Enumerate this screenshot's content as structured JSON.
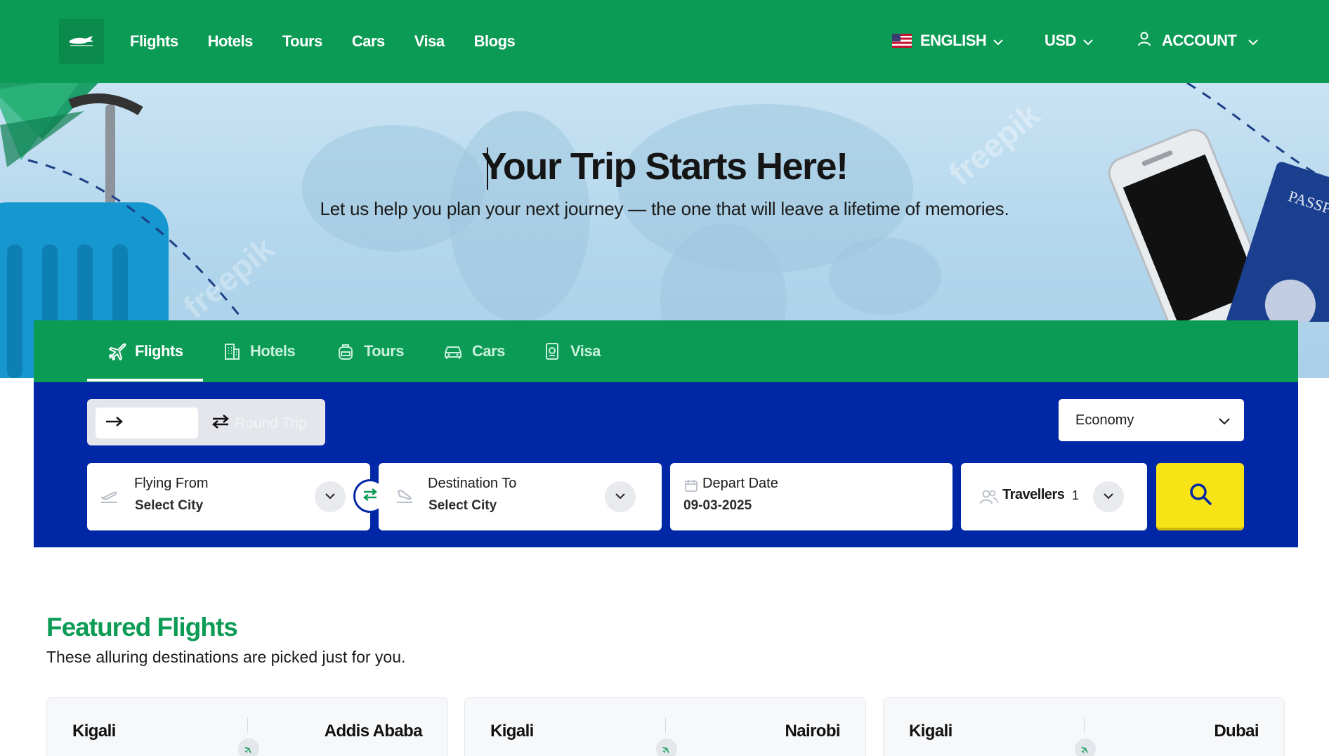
{
  "header": {
    "nav": [
      "Flights",
      "Hotels",
      "Tours",
      "Cars",
      "Visa",
      "Blogs"
    ],
    "language": "ENGLISH",
    "currency": "USD",
    "account": "ACCOUNT"
  },
  "hero": {
    "title": "Your Trip Starts Here!",
    "subtitle": "Let us help you plan your next journey — the one that will leave a lifetime of memories.",
    "watermark": "freepik",
    "passport_text": "PASSPO"
  },
  "search": {
    "tabs": [
      "Flights",
      "Hotels",
      "Tours",
      "Cars",
      "Visa"
    ],
    "active_tab": "Flights",
    "trip_type_round": "Round Trip",
    "cabin_class": "Economy",
    "from_label": "Flying From",
    "from_value": "Select City",
    "to_label": "Destination To",
    "to_value": "Select City",
    "date_label": "Depart Date",
    "date_value": "09-03-2025",
    "travellers_label": "Travellers",
    "travellers_count": "1"
  },
  "featured": {
    "title": "Featured Flights",
    "subtitle": "These alluring destinations are picked just for you.",
    "cards": [
      {
        "from": "Kigali",
        "to": "Addis Ababa"
      },
      {
        "from": "Kigali",
        "to": "Nairobi"
      },
      {
        "from": "Kigali",
        "to": "Dubai"
      }
    ]
  },
  "colors": {
    "brand_green": "#0b9b55",
    "search_blue": "#0027a6",
    "search_button_yellow": "#f7e316"
  },
  "icons": [
    "logo-icon",
    "flag-us-icon",
    "chevron-down-icon",
    "user-icon",
    "airplane-icon",
    "building-icon",
    "backpack-icon",
    "car-icon",
    "passport-icon",
    "arrow-right-icon",
    "swap-horizontal-icon",
    "takeoff-icon",
    "landing-icon",
    "swap-icon",
    "calendar-icon",
    "users-icon",
    "search-icon",
    "plane-icon"
  ]
}
